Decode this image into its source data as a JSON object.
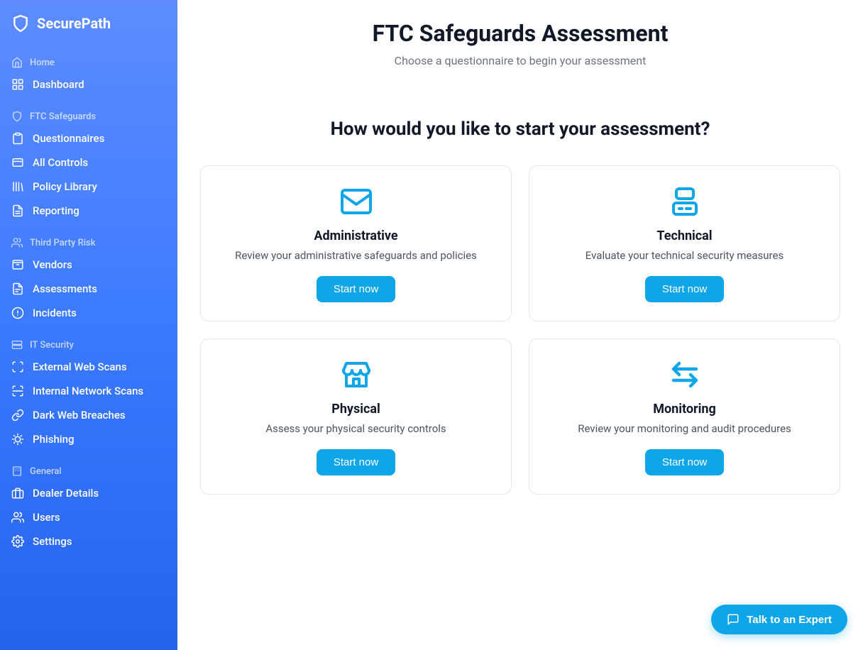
{
  "brand": "SecurePath",
  "sidebar": {
    "sections": [
      {
        "header": "Home",
        "items": [
          {
            "label": "Dashboard"
          }
        ]
      },
      {
        "header": "FTC Safeguards",
        "items": [
          {
            "label": "Questionnaires"
          },
          {
            "label": "All Controls"
          },
          {
            "label": "Policy Library"
          },
          {
            "label": "Reporting"
          }
        ]
      },
      {
        "header": "Third Party Risk",
        "items": [
          {
            "label": "Vendors"
          },
          {
            "label": "Assessments"
          },
          {
            "label": "Incidents"
          }
        ]
      },
      {
        "header": "IT Security",
        "items": [
          {
            "label": "External Web Scans"
          },
          {
            "label": "Internal Network Scans"
          },
          {
            "label": "Dark Web Breaches"
          },
          {
            "label": "Phishing"
          }
        ]
      },
      {
        "header": "General",
        "items": [
          {
            "label": "Dealer Details"
          },
          {
            "label": "Users"
          },
          {
            "label": "Settings"
          }
        ]
      }
    ]
  },
  "page": {
    "title": "FTC Safeguards Assessment",
    "subtitle": "Choose a questionnaire to begin your assessment",
    "heading": "How would you like to start your assessment?"
  },
  "cards": [
    {
      "title": "Administrative",
      "desc": "Review your administrative safeguards and policies",
      "button": "Start now"
    },
    {
      "title": "Technical",
      "desc": "Evaluate your technical security measures",
      "button": "Start now"
    },
    {
      "title": "Physical",
      "desc": "Assess your physical security controls",
      "button": "Start now"
    },
    {
      "title": "Monitoring",
      "desc": "Review your monitoring and audit procedures",
      "button": "Start now"
    }
  ],
  "fab": {
    "label": "Talk to an Expert"
  }
}
